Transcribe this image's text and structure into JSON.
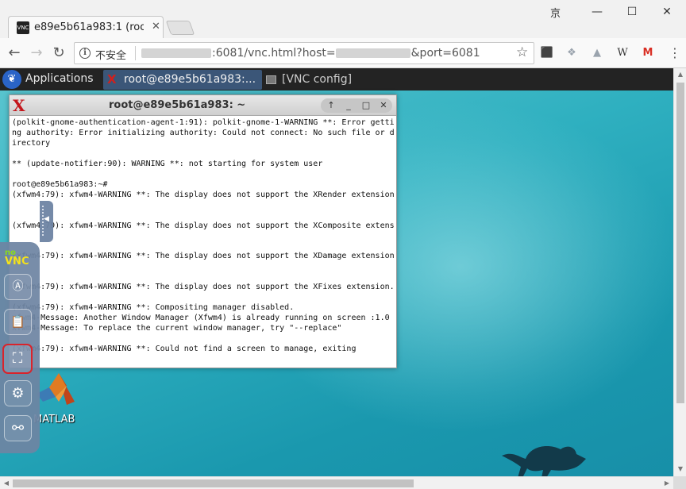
{
  "browser": {
    "tab_title": "e89e5b61a983:1 (root)",
    "tab_favicon_text": "VNC",
    "tab_close": "✕",
    "profile_char": "京",
    "window_controls": {
      "minimize": "—",
      "maximize": "☐",
      "close": "✕"
    },
    "nav": {
      "back": "←",
      "forward": "→",
      "reload": "↻"
    },
    "omnibox": {
      "security_label": "不安全",
      "url_port": ":6081/vnc.html?host=",
      "url_tail": "&port=6081"
    },
    "star": "☆",
    "extensions": [
      {
        "name": "pdf-icon",
        "glyph": "⬛",
        "color": "#b7140f"
      },
      {
        "name": "dropbox-icon",
        "glyph": "❖",
        "color": "#9aa3ad"
      },
      {
        "name": "drive-icon",
        "glyph": "▲",
        "color": "#9aa3ad"
      },
      {
        "name": "wikipedia-icon",
        "glyph": "W",
        "color": "#333333"
      },
      {
        "name": "gmail-icon",
        "glyph": "M",
        "color": "#d93025"
      }
    ],
    "menu": "⋮"
  },
  "desktop": {
    "panel": {
      "applications_label": "Applications",
      "task_active_label": "root@e89e5b61a983:...",
      "task_inactive_label": "[VNC config]"
    },
    "terminal": {
      "title": "root@e89e5b61a983: ~",
      "controls": {
        "up": "↑",
        "minimize": "_",
        "maximize": "□",
        "close": "✕"
      },
      "lines": [
        "(polkit-gnome-authentication-agent-1:91): polkit-gnome-1-WARNING **: Error getti",
        "ng authority: Error initializing authority: Could not connect: No such file or d",
        "irectory",
        "",
        "** (update-notifier:90): WARNING **: not starting for system user",
        "",
        "root@e89e5b61a983:~#",
        "(xfwm4:79): xfwm4-WARNING **: The display does not support the XRender extension",
        "",
        "",
        "(xfwm4:79): xfwm4-WARNING **: The display does not support the XComposite extens",
        "",
        "",
        "(xfwm4:79): xfwm4-WARNING **: The display does not support the XDamage extension",
        "",
        "",
        "(xfwm4:79): xfwm4-WARNING **: The display does not support the XFixes extension.",
        "",
        "(xfwm4:79): xfwm4-WARNING **: Compositing manager disabled.",
        "xfwm4-Message: Another Window Manager (Xfwm4) is already running on screen :1.0",
        "xfwm4-Message: To replace the current window manager, try \"--replace\"",
        "",
        "(xfwm4:79): xfwm4-WARNING **: Could not find a screen to manage, exiting"
      ]
    },
    "desktop_icon_label": "MATLAB"
  },
  "novnc": {
    "logo_no": "no",
    "logo_vnc": "VNC",
    "buttons": [
      {
        "name": "keyboard-button",
        "glyph": "Ⓐ"
      },
      {
        "name": "clipboard-button",
        "glyph": "📋"
      },
      {
        "name": "fullscreen-button",
        "glyph": "⛶"
      },
      {
        "name": "settings-button",
        "glyph": "⚙"
      },
      {
        "name": "disconnect-button",
        "glyph": "⚯"
      }
    ],
    "handle_arrow": "◀"
  },
  "scrollbars": {
    "up": "▲",
    "down": "▼",
    "left": "◀",
    "right": "▶"
  }
}
